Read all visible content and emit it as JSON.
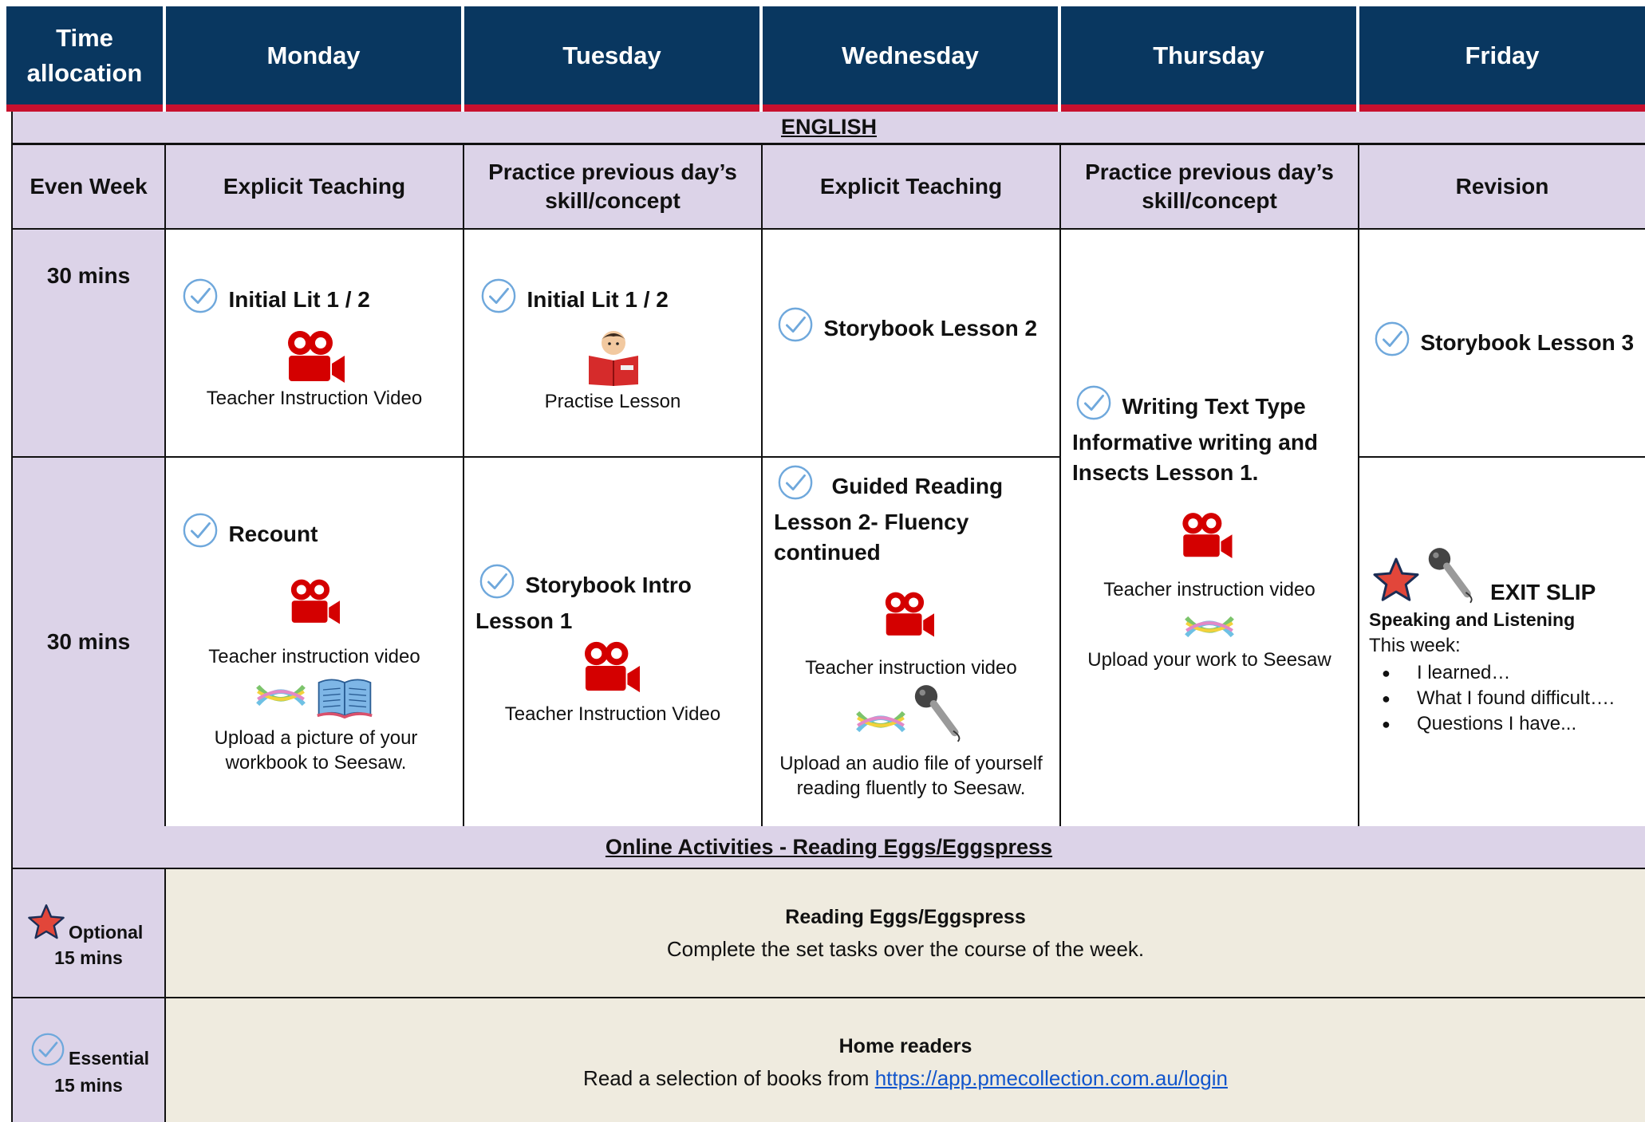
{
  "header": {
    "time_allocation": "Time allocation",
    "days": [
      "Monday",
      "Tuesday",
      "Wednesday",
      "Thursday",
      "Friday"
    ]
  },
  "english_label": "ENGLISH",
  "subheader": {
    "week": "Even Week",
    "cols": [
      "Explicit Teaching",
      "Practice previous day’s skill/concept",
      "Explicit Teaching",
      "Practice previous day’s skill/concept",
      "Revision"
    ]
  },
  "row1": {
    "time": "30 mins",
    "monday": {
      "title": "Initial Lit 1 / 2",
      "caption": "Teacher Instruction Video"
    },
    "tuesday": {
      "title": "Initial Lit 1 / 2",
      "caption": "Practise Lesson"
    },
    "wednesday": {
      "title": "Storybook Lesson 2"
    },
    "friday": {
      "title": "Storybook Lesson 3"
    }
  },
  "thursday_block": {
    "title_line1": "Writing Text Type",
    "title_line2": "Informative writing and Insects Lesson 1.",
    "caption1": "Teacher instruction video",
    "caption2": "Upload your work to Seesaw"
  },
  "row2": {
    "time": "30 mins",
    "monday": {
      "title": "Recount",
      "caption1": "Teacher instruction video",
      "caption2": "Upload a picture of your workbook to Seesaw."
    },
    "tuesday": {
      "title_line1": "Storybook Intro",
      "title_line2": "Lesson 1",
      "caption": "Teacher Instruction Video"
    },
    "wednesday": {
      "title_line1": "Guided Reading",
      "title_line2": "Lesson 2- Fluency continued",
      "caption1": "Teacher instruction video",
      "caption2": "Upload an audio file of yourself reading fluently to Seesaw."
    },
    "friday": {
      "title": "EXIT SLIP",
      "subtitle": "Speaking and Listening",
      "lead": "This week:",
      "bullets": [
        "I learned…",
        "What I found difficult….",
        "Questions I have..."
      ]
    }
  },
  "online_label": "Online Activities - Reading Eggs/Eggspress",
  "optional": {
    "label": "Optional",
    "time": "15 mins",
    "title": "Reading Eggs/Eggspress",
    "text": "Complete the set tasks over the course of the week."
  },
  "essential": {
    "label": "Essential",
    "time": "15 mins",
    "title": "Home readers",
    "text": "Read a selection of books from ",
    "link": "https://app.pmecollection.com.au/login"
  },
  "icons": {
    "check": "check-circle-icon",
    "camera": "video-camera-icon",
    "reader": "reading-child-icon",
    "seesaw": "seesaw-icon",
    "book": "open-book-icon",
    "mic": "microphone-icon",
    "star": "star-icon"
  },
  "colors": {
    "header": "#093760",
    "accent_red": "#c8102e",
    "lavender": "#dcd3e8",
    "cream": "#efebdf",
    "link": "#1155cc"
  }
}
